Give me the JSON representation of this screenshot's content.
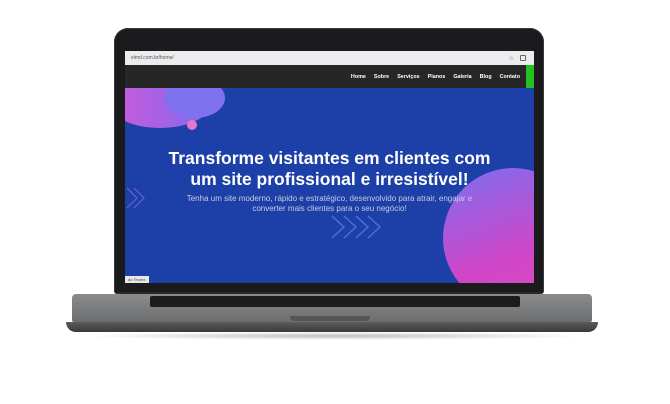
{
  "browser": {
    "url": "elmd.com.br/home/",
    "star_icon": "star-icon",
    "extension_icon": "extension-icon",
    "status_text": "do Teorex"
  },
  "nav": {
    "items": [
      "Home",
      "Sobre",
      "Serviços",
      "Planos",
      "Galeria",
      "Blog",
      "Contato"
    ],
    "cta_color": "#22c021"
  },
  "hero": {
    "headline_line1": "Transforme visitantes em clientes com",
    "headline_line2": "um site profissional e irresistível!",
    "sub_line1": "Tenha um site moderno, rápido e estratégico, desenvolvido para atrair, engajar e",
    "sub_line2": "converter mais clientes para o seu negócio!",
    "background_color": "#1d3fa8",
    "accent_color": "#d046c8"
  }
}
